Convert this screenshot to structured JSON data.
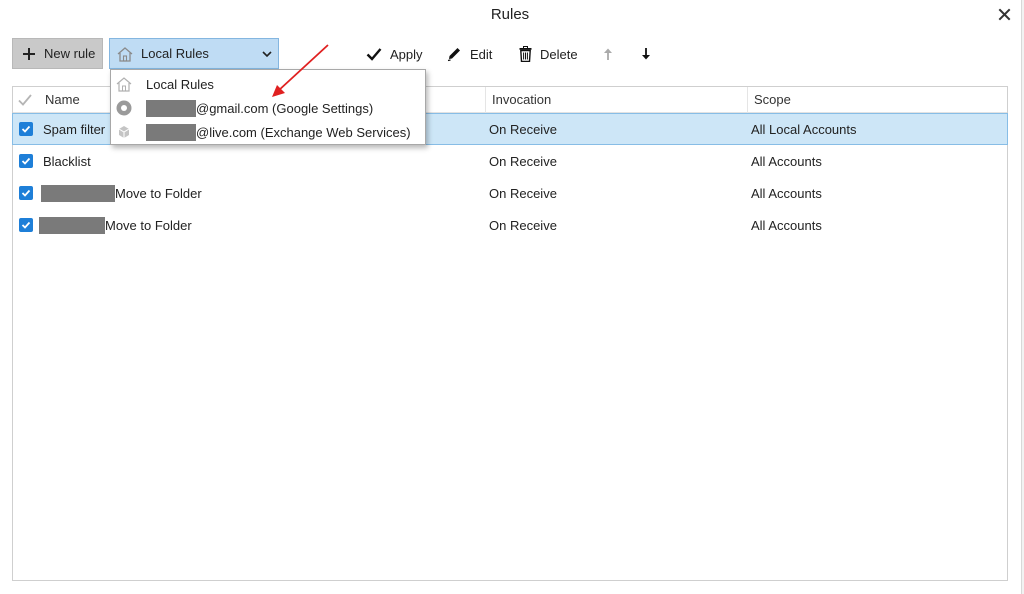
{
  "window": {
    "title": "Rules"
  },
  "toolbar": {
    "new_rule_label": "New rule",
    "scope_selected": "Local Rules",
    "apply_label": "Apply",
    "edit_label": "Edit",
    "delete_label": "Delete"
  },
  "dropdown": {
    "items": [
      {
        "label": "Local Rules",
        "icon": "home-icon"
      },
      {
        "label": "@gmail.com (Google Settings)",
        "icon": "google-settings-icon",
        "redacted_prefix": true
      },
      {
        "label": "@live.com (Exchange Web Services)",
        "icon": "exchange-icon",
        "redacted_prefix": true
      }
    ]
  },
  "table": {
    "columns": [
      "Name",
      "Invocation",
      "Scope"
    ],
    "rows": [
      {
        "name": "Spam filter",
        "invocation": "On Receive",
        "scope": "All Local Accounts",
        "checked": true,
        "selected": true,
        "redacted_prefix": false
      },
      {
        "name": "Blacklist",
        "invocation": "On Receive",
        "scope": "All Accounts",
        "checked": true,
        "selected": false,
        "redacted_prefix": false
      },
      {
        "name": "Move to Folder",
        "invocation": "On Receive",
        "scope": "All Accounts",
        "checked": true,
        "selected": false,
        "redacted_prefix": true
      },
      {
        "name": "Move to Folder",
        "invocation": "On Receive",
        "scope": "All Accounts",
        "checked": true,
        "selected": false,
        "redacted_prefix": true
      }
    ]
  },
  "colors": {
    "accent": "#1e7fd8",
    "selection": "#cde6f7",
    "combo_bg": "#bfdcf4",
    "annotation_arrow": "#e02020"
  }
}
